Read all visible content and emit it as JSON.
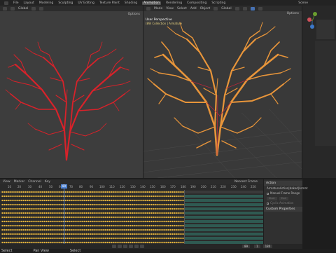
{
  "topbar": {
    "workspaces": [
      "Layout",
      "Modeling",
      "Sculpting",
      "UV Editing",
      "Texture Paint",
      "Shading",
      "Animation",
      "Rendering",
      "Compositing",
      "Scripting"
    ],
    "active_workspace": "Animation",
    "scene_label": "Scene"
  },
  "left_viewport": {
    "shading_mode": "Global",
    "options_label": "Options",
    "subject": "red heart-shaped tree branch structure"
  },
  "right_viewport": {
    "menu": [
      "Mode",
      "View",
      "Select",
      "Add",
      "Object"
    ],
    "transform": "Global",
    "options_label": "Options",
    "view_name": "User Perspective",
    "collection_path": "(89) Collection | Armature",
    "subject": "orange armature bones on heart-shaped tree"
  },
  "dopesheet": {
    "menu": [
      "View",
      "Marker",
      "Channel",
      "Key"
    ],
    "ticks": [
      "10",
      "20",
      "30",
      "40",
      "50",
      "60",
      "70",
      "80",
      "90",
      "100",
      "110",
      "120",
      "130",
      "140",
      "150",
      "160",
      "170",
      "180",
      "190",
      "200",
      "210",
      "220",
      "230",
      "240",
      "250"
    ],
    "current_frame": "89",
    "action_label": "Nearest Frame"
  },
  "action_panel": {
    "section_action": "Action",
    "action_name": "ArmatureAction|baked|Armat",
    "manual_frame_range": "Manual Frame Range",
    "start_label": "Start",
    "end_label": "End",
    "cyclic_label": "Cyclic Animation",
    "custom_properties": "Custom Properties"
  },
  "playback": {
    "frame": "89",
    "start": "1",
    "end": "180"
  },
  "statusbar": {
    "items": [
      "Select",
      "Pan View",
      "Select"
    ]
  },
  "colors": {
    "keyframe": "#e3b23c",
    "playhead": "#4f83d4",
    "branch_red": "#d8222a",
    "bone_orange": "#e8953a"
  }
}
